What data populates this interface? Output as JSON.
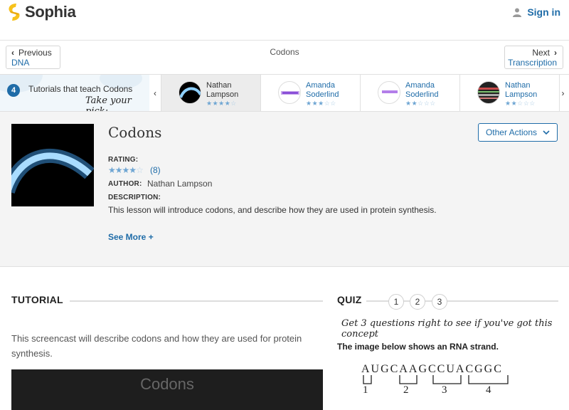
{
  "header": {
    "logo_text": "Sophia",
    "signin_label": "Sign in",
    "brand_color": "#f7c21b",
    "link_color": "#1f6ca8"
  },
  "nav": {
    "prev_label": "Previous",
    "prev_target": "DNA",
    "title": "Codons",
    "next_label": "Next",
    "next_target": "Transcription"
  },
  "tutorials": {
    "count": "4",
    "label": "Tutorials that teach Codons",
    "pick_text": "Take your pick:",
    "cards": [
      {
        "author": "Nathan Lampson",
        "stars": 4
      },
      {
        "author": "Amanda Soderlind",
        "stars": 3
      },
      {
        "author": "Amanda Soderlind",
        "stars": 2
      },
      {
        "author": "Nathan Lampson",
        "stars": 2
      }
    ]
  },
  "lesson": {
    "title": "Codons",
    "actions_label": "Other Actions",
    "rating_label": "RATING:",
    "rating_stars": 4,
    "rating_count": "(8)",
    "author_label": "AUTHOR:",
    "author": "Nathan Lampson",
    "description_label": "DESCRIPTION:",
    "description": "This lesson will introduce codons, and describe how they are used in protein synthesis.",
    "see_more": "See More +"
  },
  "tutorial_section": {
    "heading": "TUTORIAL",
    "text": "This screencast will describe codons and how they are used for protein synthesis.",
    "video_title": "Codons"
  },
  "quiz": {
    "heading": "QUIZ",
    "numbers": [
      "1",
      "2",
      "3"
    ],
    "prompt": "Get 3 questions right to see if you've got this concept",
    "question": "The image below shows an RNA strand.",
    "strand": "AUGCAAGCCUACGGC",
    "brackets": [
      "1",
      "2",
      "3",
      "4"
    ]
  }
}
